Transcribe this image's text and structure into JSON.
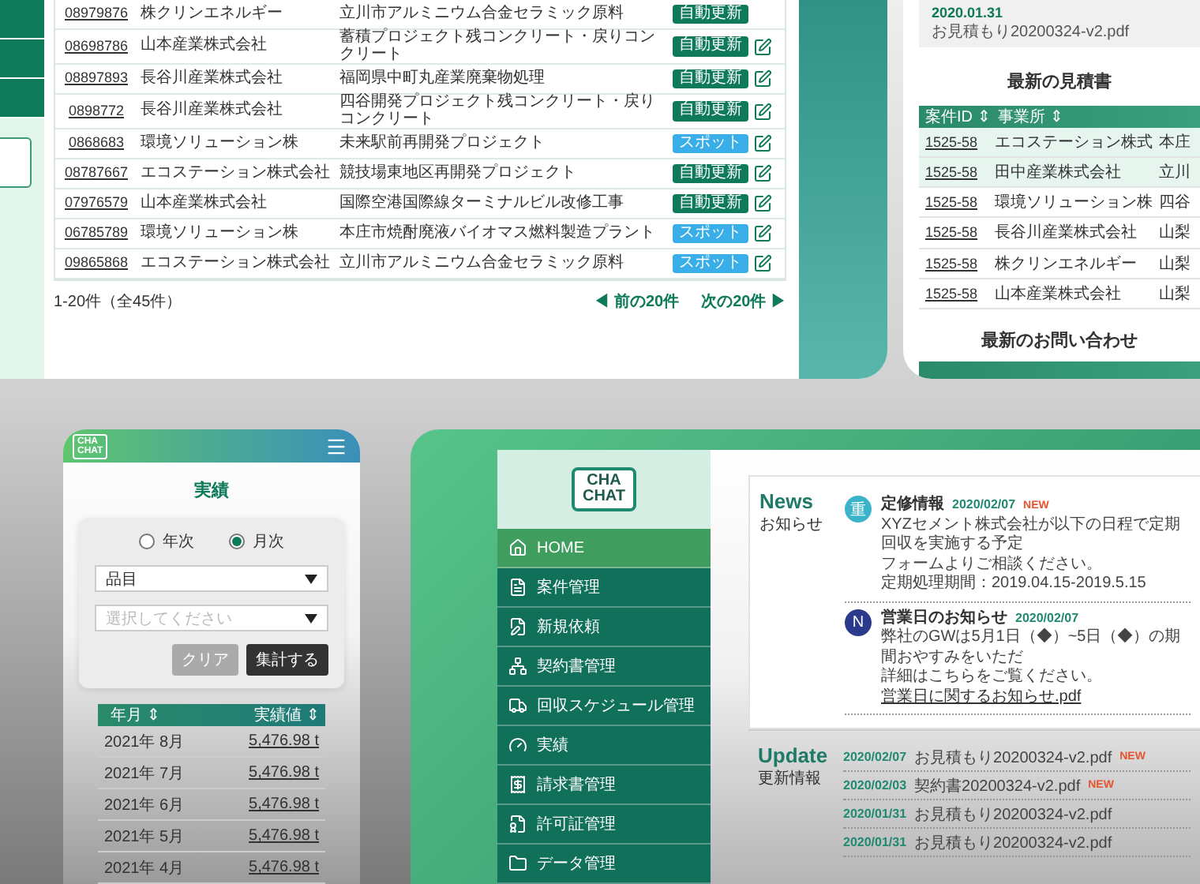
{
  "cases_panel": {
    "rows": [
      {
        "id": "08979876",
        "company": "株クリンエネルギー",
        "project": "立川市アルミニウム合金セラミック原料",
        "contract": "自動更新",
        "kind": "auto",
        "editable": false
      },
      {
        "id": "08698786",
        "company": "山本産業株式会社",
        "project": "蓄積プロジェクト残コンクリート・戻りコンクリート",
        "contract": "自動更新",
        "kind": "auto",
        "editable": true
      },
      {
        "id": "08897893",
        "company": "長谷川産業株式会社",
        "project": "福岡県中町丸産業廃棄物処理",
        "contract": "自動更新",
        "kind": "auto",
        "editable": true
      },
      {
        "id": "0898772",
        "company": "長谷川産業株式会社",
        "project": "四谷開発プロジェクト残コンクリート・戻りコンクリート",
        "contract": "自動更新",
        "kind": "auto",
        "editable": true
      },
      {
        "id": "0868683",
        "company": "環境ソリューション株",
        "project": "未来駅前再開発プロジェクト",
        "contract": "スポット",
        "kind": "spot",
        "editable": true
      },
      {
        "id": "08787667",
        "company": "エコステーション株式会社",
        "project": "競技場東地区再開発プロジェクト",
        "contract": "自動更新",
        "kind": "auto",
        "editable": true
      },
      {
        "id": "07976579",
        "company": "山本産業株式会社",
        "project": "国際空港国際線ターミナルビル改修工事",
        "contract": "自動更新",
        "kind": "auto",
        "editable": true
      },
      {
        "id": "06785789",
        "company": "環境ソリューション株",
        "project": "本庄市焼酎廃液バイオマス燃料製造プラント",
        "contract": "スポット",
        "kind": "spot",
        "editable": true
      },
      {
        "id": "09865868",
        "company": "エコステーション株式会社",
        "project": "立川市アルミニウム合金セラミック原料",
        "contract": "スポット",
        "kind": "spot",
        "editable": true
      }
    ],
    "count": "1-20件（全45件）",
    "prev": "◀ 前の20件",
    "next": "次の20件 ▶"
  },
  "quotes_panel": {
    "latest_date": "2020.01.31",
    "latest_file": "お見積もり20200324-v2.pdf",
    "title": "最新の見積書",
    "columns": [
      "案件ID ⇕",
      "事業所 ⇕"
    ],
    "rows": [
      {
        "id": "1525-58",
        "office": "エコステーション株式",
        "place": "本庄",
        "highlighted": true
      },
      {
        "id": "1525-58",
        "office": "田中産業株式会社",
        "place": "立川",
        "highlighted": true
      },
      {
        "id": "1525-58",
        "office": "環境ソリューション株",
        "place": "四谷",
        "highlighted": false
      },
      {
        "id": "1525-58",
        "office": "長谷川産業株式会社",
        "place": "山梨",
        "highlighted": false
      },
      {
        "id": "1525-58",
        "office": "株クリンエネルギー",
        "place": "山梨",
        "highlighted": false
      },
      {
        "id": "1525-58",
        "office": "山本産業株式会社",
        "place": "山梨",
        "highlighted": false
      }
    ],
    "inquiries_title": "最新のお問い合わせ"
  },
  "mobile": {
    "logo": [
      "CHA",
      "CHAT"
    ],
    "title": "実績",
    "radios": [
      {
        "label": "年次",
        "selected": false
      },
      {
        "label": "月次",
        "selected": true
      }
    ],
    "selects": [
      {
        "value": "品目"
      },
      {
        "placeholder": "選択してください"
      }
    ],
    "buttons": [
      {
        "label": "クリア",
        "disabled": true
      },
      {
        "label": "集計する",
        "disabled": false
      }
    ],
    "columns": [
      "年月 ⇕",
      "実績値 ⇕"
    ],
    "rows": [
      {
        "month": "2021年 8月",
        "value": "5,476.98 t"
      },
      {
        "month": "2021年 7月",
        "value": "5,476.98 t"
      },
      {
        "month": "2021年 6月",
        "value": "5,476.98 t"
      },
      {
        "month": "2021年 5月",
        "value": "5,476.98 t"
      },
      {
        "month": "2021年 4月",
        "value": "5,476.98 t"
      }
    ]
  },
  "desktop": {
    "logo": [
      "CHA",
      "CHAT"
    ],
    "menu": [
      {
        "label": "HOME",
        "kind": "home",
        "selected": true
      },
      {
        "label": "案件管理",
        "kind": "case",
        "selected": false
      },
      {
        "label": "新規依頼",
        "kind": "request",
        "selected": false
      },
      {
        "label": "契約書管理",
        "kind": "contract",
        "selected": false
      },
      {
        "label": "回収スケジュール管理",
        "kind": "schedule",
        "selected": false
      },
      {
        "label": "実績",
        "kind": "results",
        "selected": false
      },
      {
        "label": "請求書管理",
        "kind": "invoice",
        "selected": false
      },
      {
        "label": "許可証管理",
        "kind": "permit",
        "selected": false
      },
      {
        "label": "データ管理",
        "kind": "data",
        "selected": false
      }
    ],
    "news": {
      "heading": "News",
      "subheading": "お知らせ",
      "items": [
        {
          "avatar": "重",
          "color": "#3bb3c9",
          "title": "定修情報",
          "date": "2020/02/07",
          "badge": "NEW",
          "lines": [
            "XYZセメント株式会社が以下の日程で定期回収を実施する予定",
            "フォームよりご相談ください。",
            "定期処理期間：2019.04.15-2019.5.15"
          ]
        },
        {
          "avatar": "N",
          "color": "#2b3a8c",
          "title": "営業日のお知らせ",
          "date": "2020/02/07",
          "lines": [
            "弊社のGWは5月1日（◆）~5日（◆）の期間おやすみをいただ",
            "詳細はこちらをご覧ください。"
          ],
          "link": "営業日に関するお知らせ.pdf"
        }
      ]
    },
    "updates": {
      "heading": "Update",
      "subheading": "更新情報",
      "items": [
        {
          "date": "2020/02/07",
          "file": "お見積もり20200324-v2.pdf",
          "badge": "NEW"
        },
        {
          "date": "2020/02/03",
          "file": "契約書20200324-v2.pdf",
          "badge": "NEW"
        },
        {
          "date": "2020/01/31",
          "file": "お見積もり20200324-v2.pdf"
        },
        {
          "date": "2020/01/31",
          "file": "お見積もり20200324-v2.pdf"
        }
      ]
    }
  }
}
